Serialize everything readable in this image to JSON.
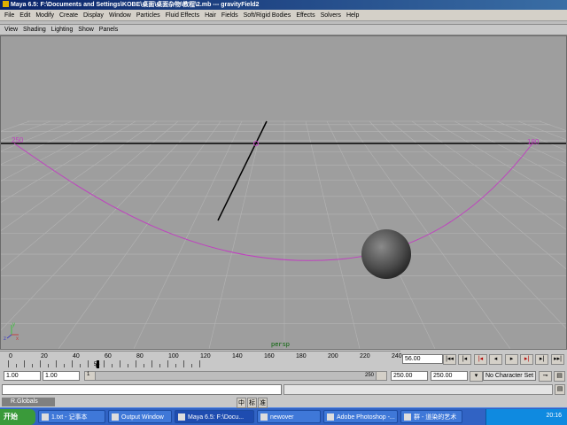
{
  "window": {
    "title": "Maya 6.5: F:\\Documents and Settings\\KOBE\\桌面\\桌面杂物\\教程\\2.mb  ---  gravityField2"
  },
  "menubar": {
    "items": [
      "File",
      "Edit",
      "Modify",
      "Create",
      "Display",
      "Window",
      "Particles",
      "Fluid Effects",
      "Hair",
      "Fields",
      "Soft/Rigid Bodies",
      "Effects",
      "Solvers",
      "Help"
    ]
  },
  "panel_menu": {
    "items": [
      "View",
      "Shading",
      "Lighting",
      "Show",
      "Panels"
    ]
  },
  "viewport": {
    "camera_label": "persp",
    "curve_label_left": "250",
    "curve_label_right": "180",
    "axis": {
      "x": "x",
      "y": "y",
      "z": "z"
    }
  },
  "timeline": {
    "ticks": [
      "0",
      "20",
      "40",
      "60",
      "80",
      "100",
      "120",
      "140",
      "160",
      "180",
      "200",
      "220",
      "240"
    ],
    "current_frame_marker": "56",
    "current_time": "56.00"
  },
  "range": {
    "start_time": "1.00",
    "playback_start": "1.00",
    "slider_left_label": "1",
    "slider_right_label": "250",
    "playback_end": "250.00",
    "end_time": "250.00",
    "character_set": "No Character Set"
  },
  "helpline": {
    "globals_label": "R.Globals"
  },
  "taskbar": {
    "start_label": "开始",
    "tasks": [
      "1.txt - 记事本",
      "Output Window",
      "Maya 6.5: F:\\Docu...",
      "newover",
      "Adobe Photoshop -...",
      "群 - 道染的艺术"
    ],
    "ime": [
      "中",
      "标",
      "准"
    ],
    "clock": "20:16"
  },
  "colors": {
    "viewport_bg": "#9e9e9e",
    "grid": "#b4b4b4",
    "curve": "#c040c0",
    "taskbar": "#3163c4"
  }
}
